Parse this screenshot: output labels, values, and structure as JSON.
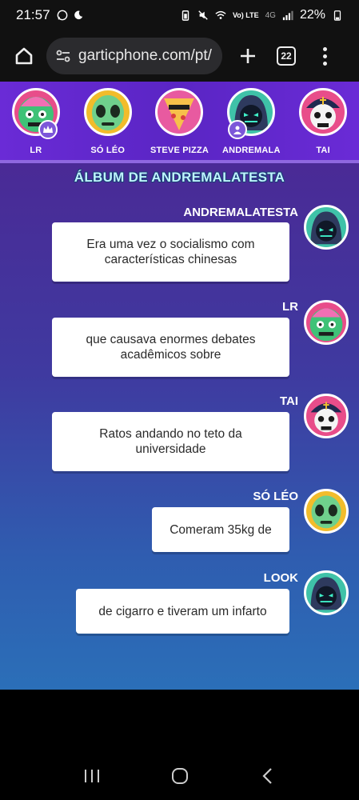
{
  "status": {
    "time": "21:57",
    "network": "Vo) LTE",
    "signal_type": "4G",
    "battery": "22%"
  },
  "browser": {
    "url": "garticphone.com/pt/",
    "tab_count": "22"
  },
  "players": [
    {
      "name": "LR",
      "badge": "crown-icon"
    },
    {
      "name": "SÓ LÉO",
      "badge": ""
    },
    {
      "name": "STEVE PIZZA",
      "badge": ""
    },
    {
      "name": "ANDREMALA",
      "badge": "user-icon"
    },
    {
      "name": "TAI",
      "badge": ""
    }
  ],
  "album": {
    "title": "ÁLBUM DE ANDREMALATESTA",
    "entries": [
      {
        "author": "ANDREMALATESTA",
        "text": "Era uma vez o socialismo com características chinesas"
      },
      {
        "author": "LR",
        "text": "que causava enormes debates acadêmicos sobre"
      },
      {
        "author": "TAI",
        "text": "Ratos andando no teto da universidade"
      },
      {
        "author": "SÓ LÉO",
        "text": "Comeram 35kg de"
      },
      {
        "author": "LOOK",
        "text": "de cigarro e tiveram um infarto"
      }
    ]
  },
  "colors": {
    "player_strip": "#5a25c4",
    "title_text": "#bff4ff",
    "bubble": "#ffffff"
  }
}
